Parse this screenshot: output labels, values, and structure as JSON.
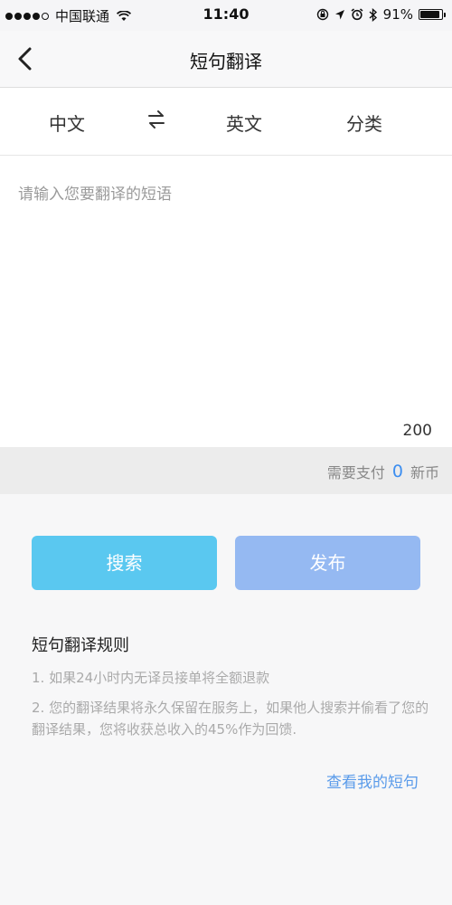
{
  "status_bar": {
    "carrier": "中国联通",
    "time": "11:40",
    "battery": "91%",
    "battery_level": 0.91
  },
  "nav": {
    "title": "短句翻译"
  },
  "lang_bar": {
    "source": "中文",
    "target": "英文",
    "category": "分类"
  },
  "input": {
    "placeholder": "请输入您要翻译的短语",
    "value": "",
    "char_limit": "200"
  },
  "payment": {
    "prefix": "需要支付",
    "amount": "0",
    "unit": "新币"
  },
  "actions": {
    "search_label": "搜索",
    "publish_label": "发布"
  },
  "rules": {
    "title": "短句翻译规则",
    "items": [
      "1. 如果24小时内无译员接单将全额退款",
      "2. 您的翻译结果将永久保留在服务上，如果他人搜索并偷看了您的翻译结果，您将收获总收入的45%作为回馈."
    ]
  },
  "link": {
    "view_mine": "查看我的短句"
  },
  "colors": {
    "search_button": "#5ac8f0",
    "publish_button": "#95b9f2",
    "link": "#5a9bea",
    "amount": "#3c8ef0"
  }
}
